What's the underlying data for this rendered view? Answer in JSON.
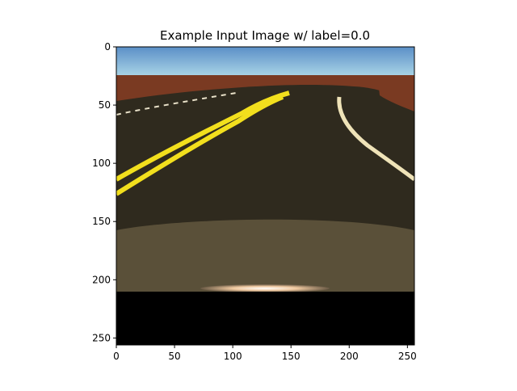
{
  "chart_data": {
    "type": "image",
    "title": "Example Input Image w/ label=0.0",
    "xlabel": "",
    "ylabel": "",
    "xlim": [
      0,
      256
    ],
    "ylim": [
      256,
      0
    ],
    "xticks": [
      0,
      50,
      100,
      150,
      200,
      250
    ],
    "yticks": [
      0,
      50,
      100,
      150,
      200,
      250
    ],
    "image": {
      "description_scene": "driving simulator road view",
      "sky_color_top": "#5b8fc7",
      "sky_color_bottom": "#a9d4e6",
      "ground_color": "#7a3a22",
      "road_color": "#2f2a1e",
      "hood_color": "#5a5039",
      "bottom_color": "#000000",
      "yellow_line_color": "#f2df1d",
      "white_line_color": "#efe3b8"
    }
  }
}
